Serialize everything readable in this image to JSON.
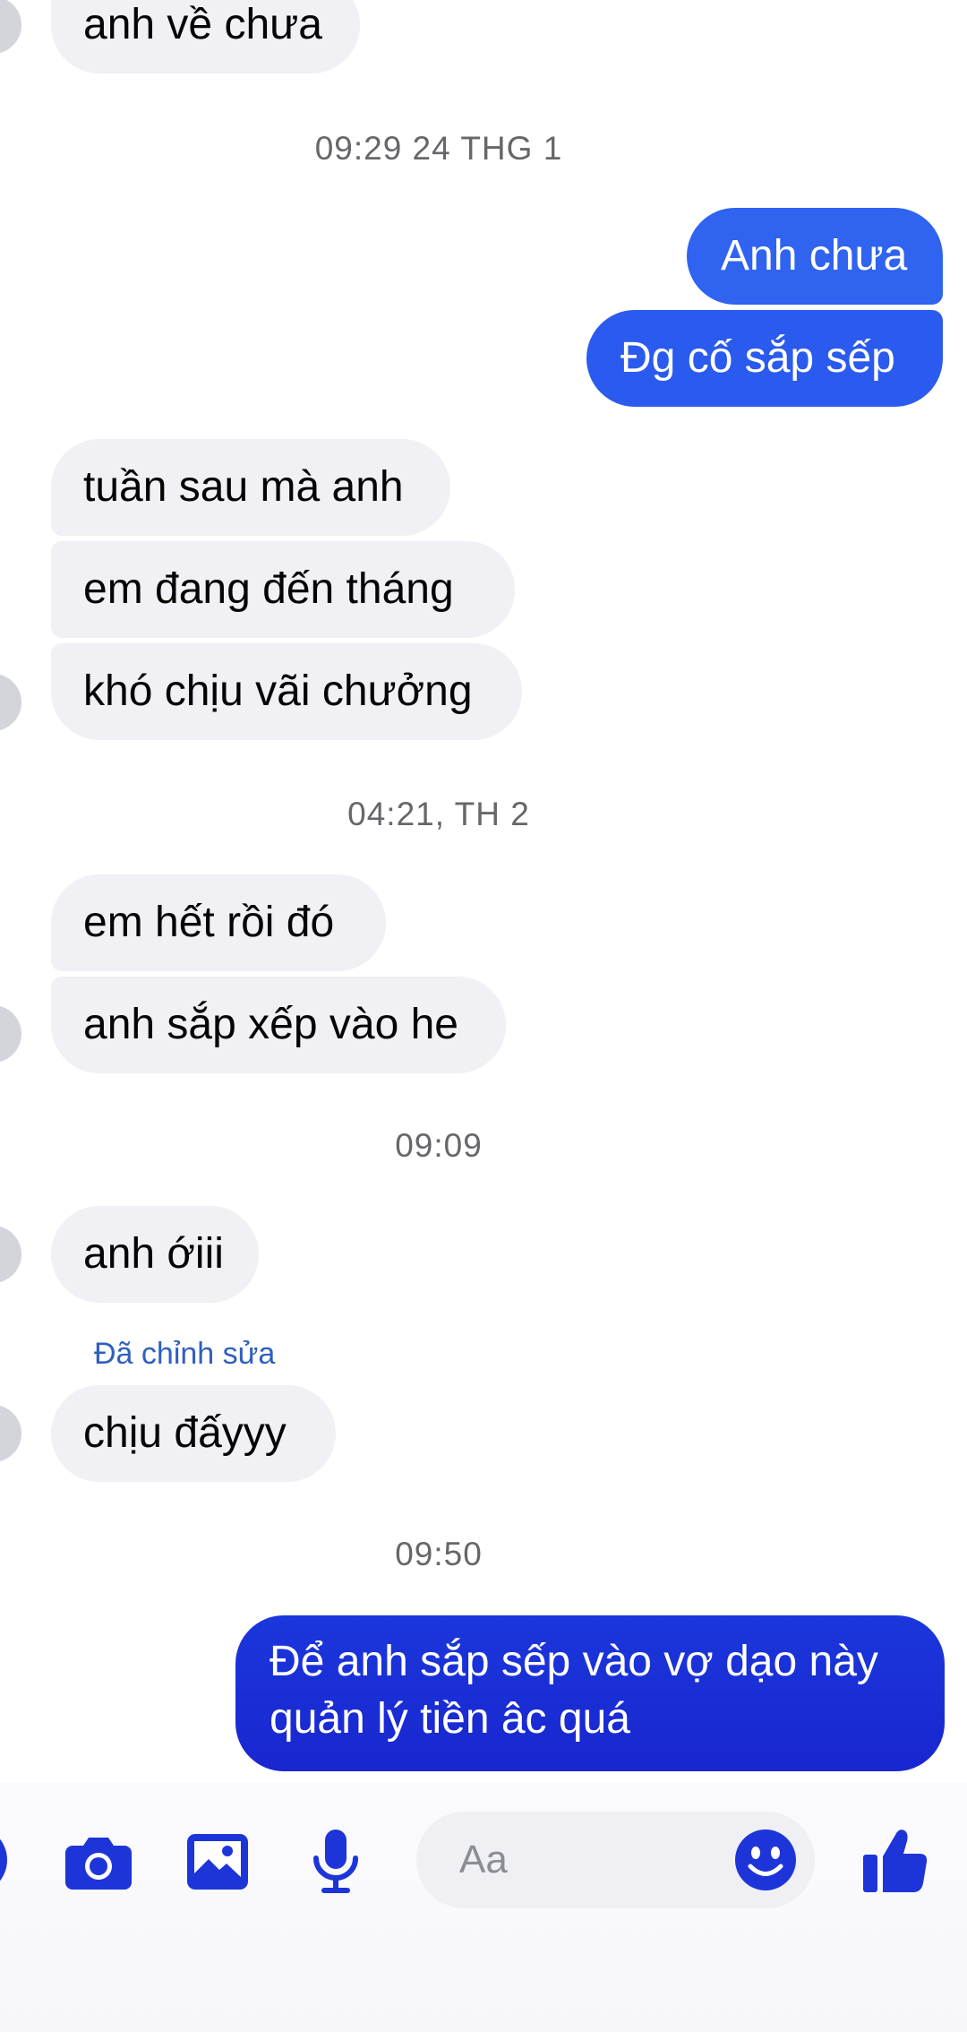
{
  "colors": {
    "incoming_bubble": "#f0f0f5",
    "outgoing_bubble_top": "#2f63f0",
    "outgoing_bubble_bottom": "#1a2ad6",
    "accent_icon": "#1d35d8",
    "timestamp": "#65676b",
    "edited_label": "#2f5fbf"
  },
  "messages": {
    "m0": "anh về chưa",
    "ts1": "09:29 24 THG 1",
    "m1": "Anh chưa",
    "m2": "Đg cố sắp sếp",
    "m3": "tuần sau mà anh",
    "m4": "em đang đến tháng",
    "m5": "khó chịu vãi chưởng",
    "ts2": "04:21, TH 2",
    "m6": "em hết rồi đó",
    "m7": "anh sắp xếp vào he",
    "ts3": "09:09",
    "m8": "anh ớiii",
    "edited": "Đã chỉnh sửa",
    "m9": "chịu đấyyy",
    "ts4": "09:50",
    "m10_line1": "Để anh sắp sếp vào vợ dạo này",
    "m10_line2": "quản lý tiền âc quá"
  },
  "composer": {
    "placeholder": "Aa",
    "icons": [
      "more-actions-icon",
      "camera-icon",
      "photo-gallery-icon",
      "microphone-icon",
      "emoji-icon",
      "thumbs-up-icon"
    ]
  }
}
